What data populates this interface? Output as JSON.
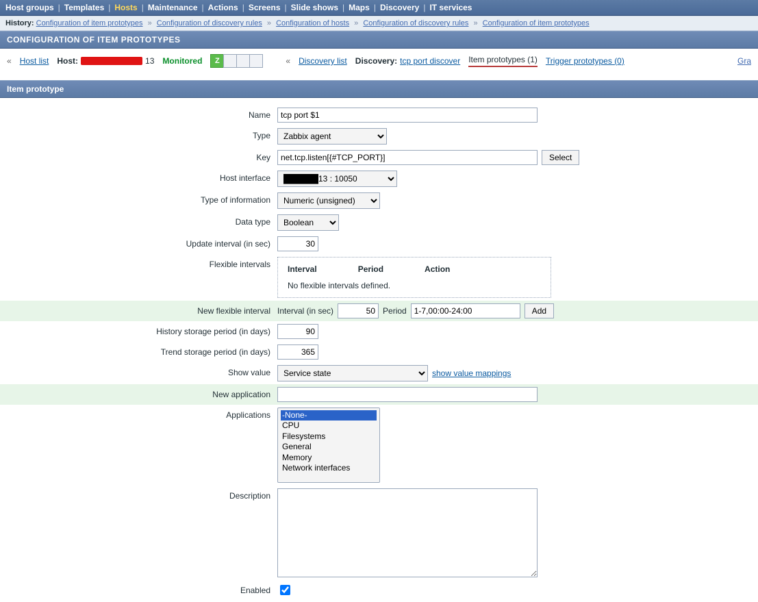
{
  "nav": {
    "items": [
      "Host groups",
      "Templates",
      "Hosts",
      "Maintenance",
      "Actions",
      "Screens",
      "Slide shows",
      "Maps",
      "Discovery",
      "IT services"
    ],
    "active_index": 2
  },
  "history": {
    "label": "History:",
    "items": [
      "Configuration of item prototypes",
      "Configuration of discovery rules",
      "Configuration of hosts",
      "Configuration of discovery rules",
      "Configuration of item prototypes"
    ]
  },
  "page": {
    "title": "CONFIGURATION OF ITEM PROTOTYPES",
    "section_title": "Item prototype"
  },
  "toolbar": {
    "laquo1": "«",
    "host_list": "Host list",
    "host_label": "Host:",
    "host_suffix": "13",
    "monitored": "Monitored",
    "z": "Z",
    "laquo2": "«",
    "discovery_list": "Discovery list",
    "discovery_label": "Discovery:",
    "discovery_link": "tcp port discover",
    "item_proto": "Item prototypes (1)",
    "trigger_proto": "Trigger prototypes (0)",
    "graph_cut": "Gra"
  },
  "form": {
    "name": {
      "label": "Name",
      "value": "tcp port $1"
    },
    "type": {
      "label": "Type",
      "value": "Zabbix agent"
    },
    "key": {
      "label": "Key",
      "value": "net.tcp.listen[{#TCP_PORT}]",
      "select": "Select"
    },
    "host_if": {
      "label": "Host interface",
      "suffix": "13 : 10050"
    },
    "info_type": {
      "label": "Type of information",
      "value": "Numeric (unsigned)"
    },
    "data_type": {
      "label": "Data type",
      "value": "Boolean"
    },
    "update_int": {
      "label": "Update interval (in sec)",
      "value": "30"
    },
    "flex_intervals": {
      "label": "Flexible intervals",
      "hdr_interval": "Interval",
      "hdr_period": "Period",
      "hdr_action": "Action",
      "empty": "No flexible intervals defined."
    },
    "new_flex": {
      "label": "New flexible interval",
      "int_label": "Interval (in sec)",
      "int_value": "50",
      "period_label": "Period",
      "period_value": "1-7,00:00-24:00",
      "add": "Add"
    },
    "history": {
      "label": "History storage period (in days)",
      "value": "90"
    },
    "trend": {
      "label": "Trend storage period (in days)",
      "value": "365"
    },
    "show_value": {
      "label": "Show value",
      "value": "Service state",
      "link": "show value mappings"
    },
    "new_app": {
      "label": "New application",
      "value": ""
    },
    "apps": {
      "label": "Applications",
      "options": [
        "-None-",
        "CPU",
        "Filesystems",
        "General",
        "Memory",
        "Network interfaces"
      ],
      "selected_index": 0
    },
    "description": {
      "label": "Description",
      "value": ""
    },
    "enabled": {
      "label": "Enabled",
      "checked": true
    }
  }
}
